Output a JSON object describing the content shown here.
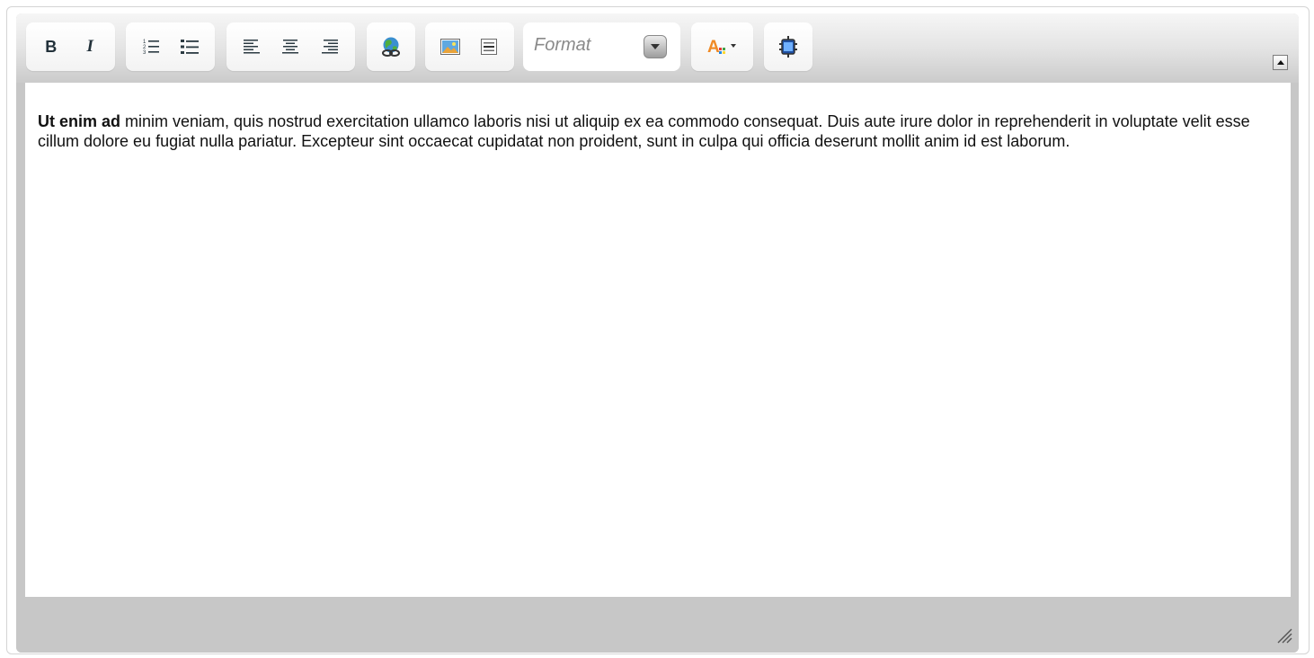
{
  "toolbar": {
    "bold_label": "B",
    "italic_label": "I",
    "format_placeholder": "Format",
    "icons": {
      "bold": "bold-icon",
      "italic": "italic-icon",
      "ordered_list": "numbered-list-icon",
      "unordered_list": "bullet-list-icon",
      "align_left": "align-left-icon",
      "align_center": "align-center-icon",
      "align_right": "align-right-icon",
      "link": "link-globe-icon",
      "image": "image-icon",
      "horizontal_rule": "horizontal-rule-icon",
      "text_color": "text-color-icon",
      "source": "source-view-icon",
      "collapse": "collapse-arrow-icon"
    }
  },
  "content": {
    "bold_text": "Ut enim ad",
    "body_text": " minim veniam, quis nostrud exercitation ullamco laboris nisi ut aliquip ex ea commodo consequat. Duis aute irure dolor in reprehenderit in voluptate velit esse cillum dolore eu fugiat nulla pariatur. Excepteur sint occaecat cupidatat non proident, sunt in culpa qui officia deserunt mollit anim id est laborum."
  },
  "colors": {
    "toolbar_bg": "#e4e4e4",
    "frame_bg": "#c7c7c7",
    "text": "#111111",
    "icon_dark": "#2b3a42"
  }
}
